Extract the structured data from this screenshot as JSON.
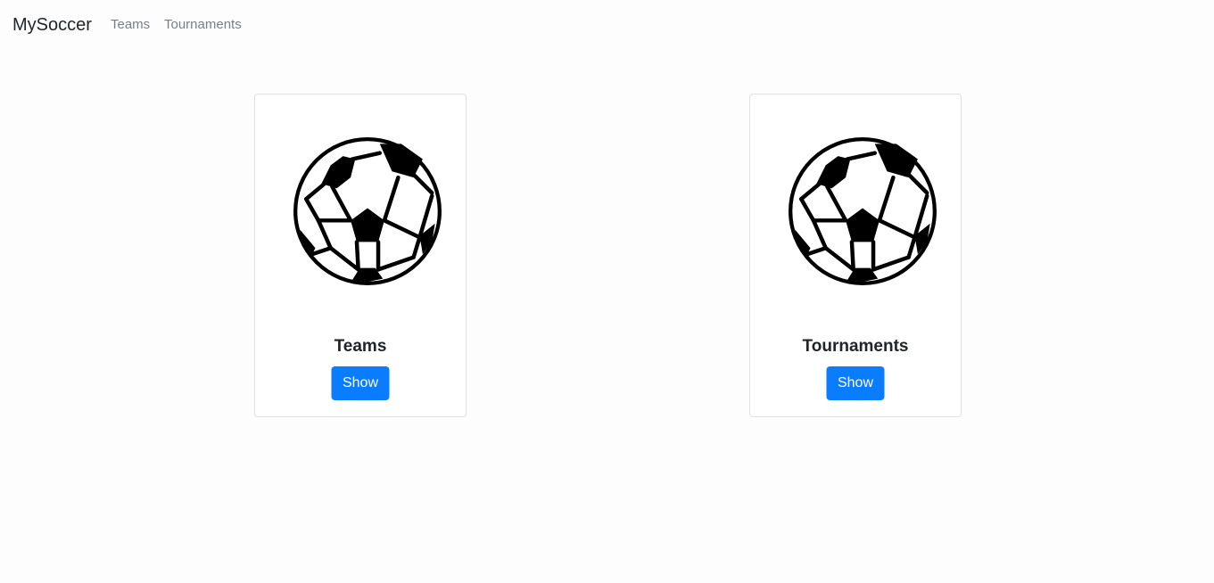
{
  "navbar": {
    "brand": "MySoccer",
    "links": [
      {
        "label": "Teams"
      },
      {
        "label": "Tournaments"
      }
    ]
  },
  "cards": [
    {
      "title": "Teams",
      "button_label": "Show",
      "icon": "soccer-ball-icon"
    },
    {
      "title": "Tournaments",
      "button_label": "Show",
      "icon": "soccer-ball-icon"
    }
  ],
  "colors": {
    "primary_button": "#0a7cff",
    "background": "#fdfdfd",
    "nav_link": "#7a7f85"
  }
}
